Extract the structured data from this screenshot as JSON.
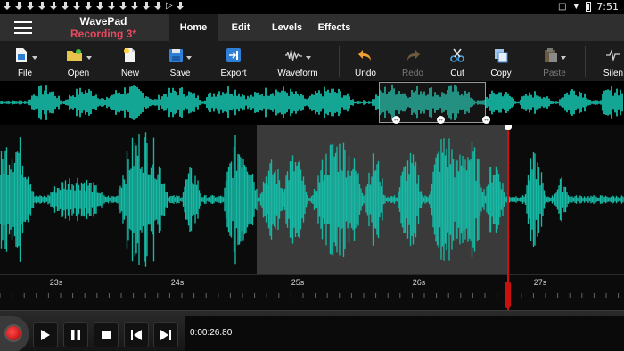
{
  "status_bar": {
    "notification_icons": [
      "download-icon",
      "download-icon",
      "download-icon",
      "download-icon",
      "download-icon",
      "download-icon",
      "download-icon",
      "download-icon",
      "download-icon",
      "download-icon",
      "download-icon",
      "download-icon",
      "download-icon",
      "download-icon",
      "play-store-icon",
      "download-icon"
    ],
    "time": "7:51"
  },
  "header": {
    "app_name": "WavePad",
    "file_name": "Recording 3*",
    "tabs": [
      {
        "label": "Home",
        "active": true
      },
      {
        "label": "Edit",
        "active": false
      },
      {
        "label": "Levels",
        "active": false
      },
      {
        "label": "Effects",
        "active": false
      }
    ]
  },
  "toolbar": {
    "buttons": [
      {
        "label": "File",
        "icon": "file-icon",
        "enabled": true
      },
      {
        "label": "Open",
        "icon": "open-folder-icon",
        "enabled": true
      },
      {
        "label": "New",
        "icon": "new-file-icon",
        "enabled": true
      },
      {
        "label": "Save",
        "icon": "save-icon",
        "enabled": true
      },
      {
        "label": "Export",
        "icon": "export-icon",
        "enabled": true
      },
      {
        "label": "Waveform",
        "icon": "waveform-icon",
        "enabled": true
      },
      {
        "label": "Undo",
        "icon": "undo-icon",
        "enabled": true
      },
      {
        "label": "Redo",
        "icon": "redo-icon",
        "enabled": false
      },
      {
        "label": "Cut",
        "icon": "scissors-icon",
        "enabled": true
      },
      {
        "label": "Copy",
        "icon": "copy-icon",
        "enabled": true
      },
      {
        "label": "Paste",
        "icon": "paste-icon",
        "enabled": false
      },
      {
        "label": "Silen",
        "icon": "silence-icon",
        "enabled": true
      }
    ]
  },
  "timeline": {
    "ticks": [
      "23s",
      "24s",
      "25s",
      "26s",
      "27s"
    ]
  },
  "transport": {
    "current_time": "0:00:26.80"
  },
  "colors": {
    "waveform": "#17b8a4",
    "selection": "#3a3a3a",
    "playhead": "#d01010",
    "file_name": "#e84a5f",
    "toolbar_bg": "#1c1c1c",
    "header_bg": "#2f2f2f"
  }
}
